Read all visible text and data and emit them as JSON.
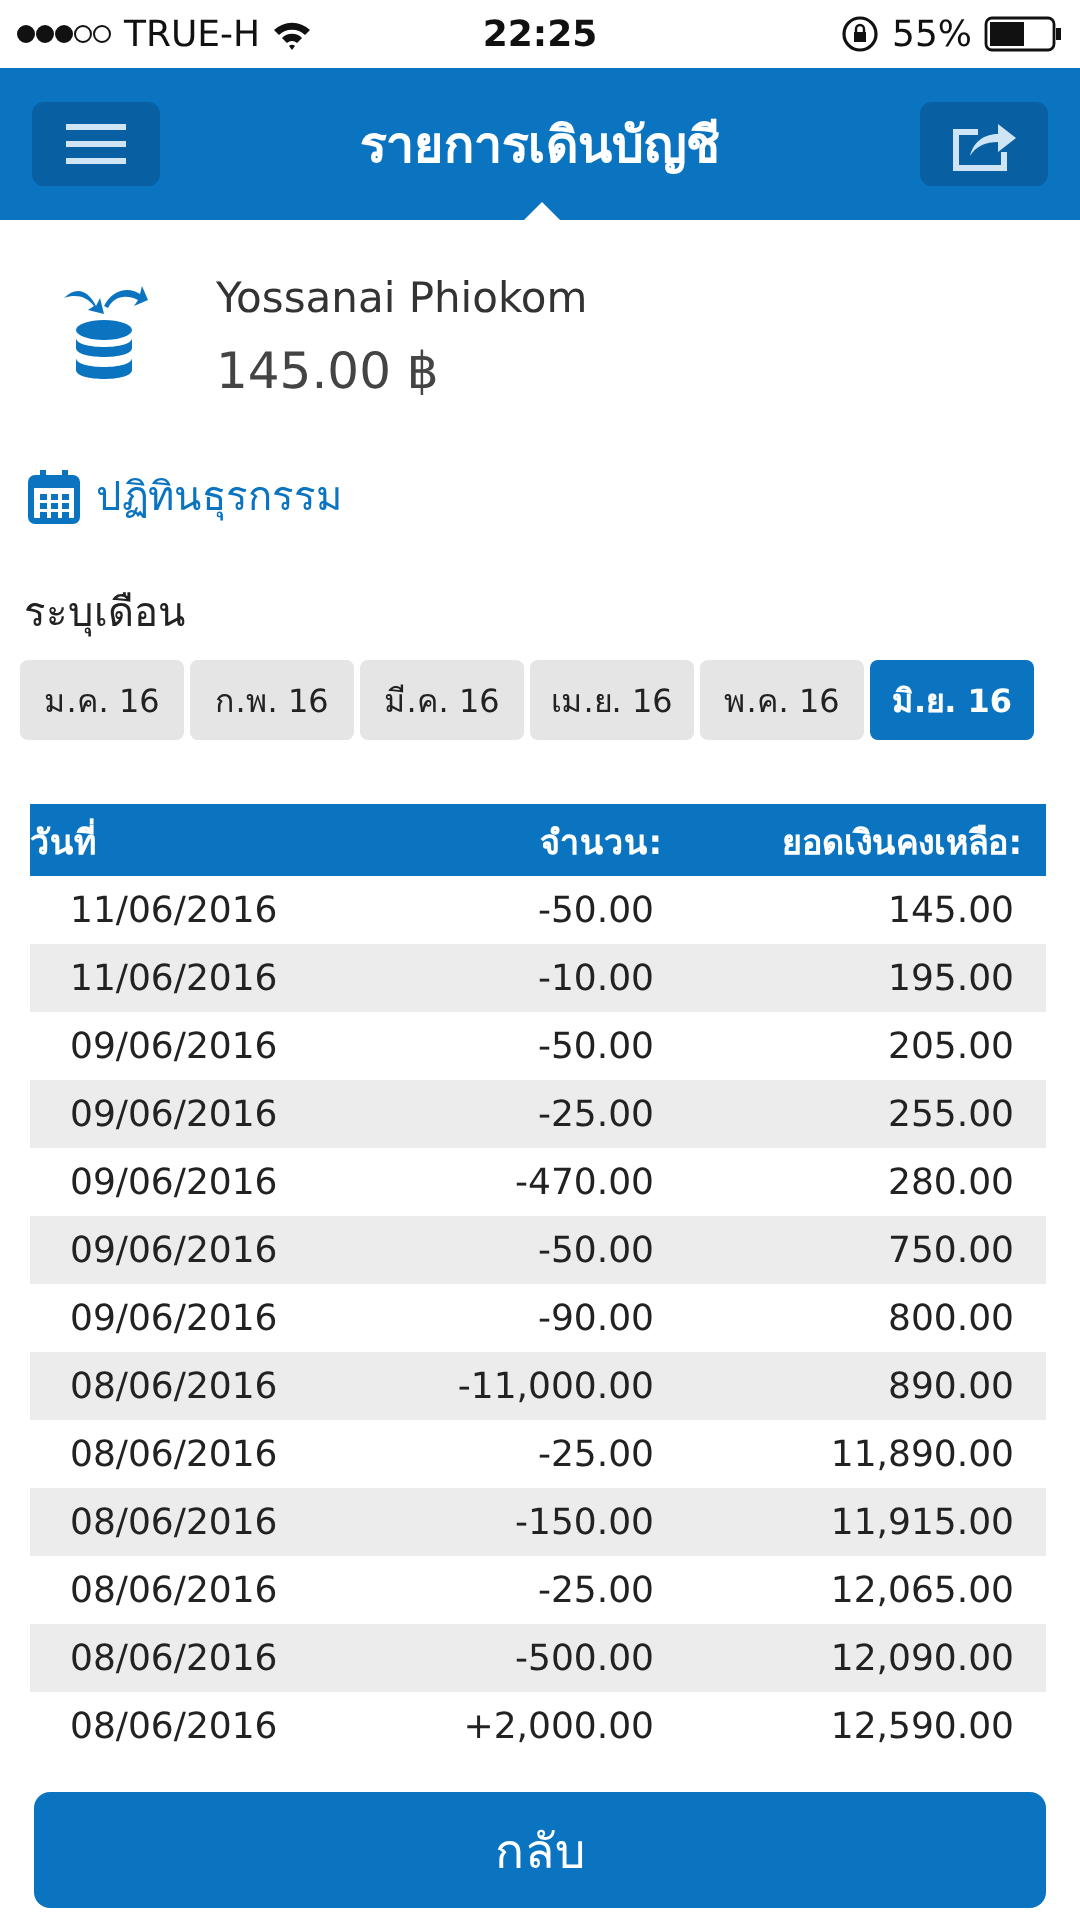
{
  "status_bar": {
    "carrier": "TRUE-H",
    "time": "22:25",
    "battery": "55%"
  },
  "header": {
    "title": "รายการเดินบัญชี"
  },
  "account": {
    "name": "Yossanai Phiokom",
    "balance": "145.00 ฿"
  },
  "calendar_link": "ปฏิทินธุรกรรม",
  "month_label": "ระบุเดือน",
  "months": [
    {
      "label": "ม.ค. 16",
      "selected": false
    },
    {
      "label": "ก.พ. 16",
      "selected": false
    },
    {
      "label": "มี.ค. 16",
      "selected": false
    },
    {
      "label": "เม.ย. 16",
      "selected": false
    },
    {
      "label": "พ.ค. 16",
      "selected": false
    },
    {
      "label": "มิ.ย. 16",
      "selected": true
    }
  ],
  "table": {
    "columns": [
      "วันที่",
      "จำนวน:",
      "ยอดเงินคงเหลือ:"
    ],
    "rows": [
      [
        "11/06/2016",
        "-50.00",
        "145.00"
      ],
      [
        "11/06/2016",
        "-10.00",
        "195.00"
      ],
      [
        "09/06/2016",
        "-50.00",
        "205.00"
      ],
      [
        "09/06/2016",
        "-25.00",
        "255.00"
      ],
      [
        "09/06/2016",
        "-470.00",
        "280.00"
      ],
      [
        "09/06/2016",
        "-50.00",
        "750.00"
      ],
      [
        "09/06/2016",
        "-90.00",
        "800.00"
      ],
      [
        "08/06/2016",
        "-11,000.00",
        "890.00"
      ],
      [
        "08/06/2016",
        "-25.00",
        "11,890.00"
      ],
      [
        "08/06/2016",
        "-150.00",
        "11,915.00"
      ],
      [
        "08/06/2016",
        "-25.00",
        "12,065.00"
      ],
      [
        "08/06/2016",
        "-500.00",
        "12,090.00"
      ],
      [
        "08/06/2016",
        "+2,000.00",
        "12,590.00"
      ]
    ]
  },
  "back_button": "กลับ"
}
